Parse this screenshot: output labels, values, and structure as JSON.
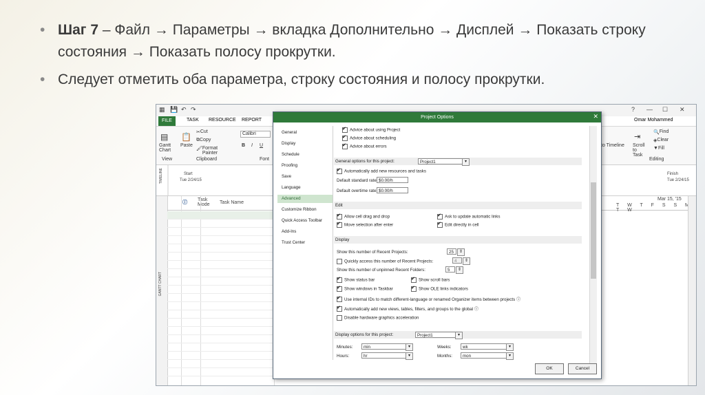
{
  "slide": {
    "bullet1_bold": "Шаг 7",
    "bullet1_text": " – Файл → Параметры → вкладка Дополнительно → Дисплей → Показать строку состояния → Показать полосу прокрутки.",
    "bullet2_text": "Следует отметить оба параметра, строку состояния и полосу прокрутки.",
    "bullet_char": "•"
  },
  "project": {
    "tabs": [
      "FILE",
      "TASK",
      "RESOURCE",
      "REPORT"
    ],
    "user": "Omar Mohammed",
    "ribbon": {
      "gantt_chart": "Gantt Chart",
      "paste": "Paste",
      "cut": "Cut",
      "copy": "Copy",
      "format_painter": "Format Painter",
      "font": "Calibri",
      "view_group": "View",
      "clipboard_group": "Clipboard",
      "font_group": "Font",
      "add_to_timeline": "to Timeline",
      "scroll_to_task": "Scroll to Task",
      "find": "Find",
      "clear": "Clear",
      "fill": "Fill",
      "editing_group": "Editing"
    },
    "timeline": {
      "label": "TIMELINE",
      "start_label": "Start",
      "start_date": "Tue 2/24/15",
      "finish_label": "Finish",
      "finish_date": "Tue 2/24/15"
    },
    "grid": {
      "task_mode": "Task Mode",
      "task_name": "Task Name",
      "gantt_label": "GANTT CHART",
      "date_header": "Mar 15, '15",
      "days": "T W T F S S M T W"
    }
  },
  "dialog": {
    "title": "Project Options",
    "nav": [
      "General",
      "Display",
      "Schedule",
      "Proofing",
      "Save",
      "Language",
      "Advanced",
      "Customize Ribbon",
      "Quick Access Toolbar",
      "Add-Ins",
      "Trust Center"
    ],
    "active_nav": "Advanced",
    "top_opts": [
      {
        "label": "Advice about using Project",
        "checked": true
      },
      {
        "label": "Advice about scheduling",
        "checked": true
      },
      {
        "label": "Advice about errors",
        "checked": true
      }
    ],
    "general_section": "General options for this project:",
    "project_name": "Project1",
    "auto_add": "Automatically add new resources and tasks",
    "std_rate_label": "Default standard rate:",
    "std_rate": "$0.00/h",
    "ot_rate_label": "Default overtime rate:",
    "ot_rate": "$0.00/h",
    "edit_section": "Edit",
    "edit_opts": {
      "drag": "Allow cell drag and drop",
      "move": "Move selection after enter",
      "ask": "Ask to update automatic links",
      "direct": "Edit directly in cell"
    },
    "display_section": "Display",
    "recent_projects_label": "Show this number of Recent Projects:",
    "recent_projects": "25",
    "quick_access_label": "Quickly access this number of Recent Projects:",
    "quick_access": "4",
    "unpinned_label": "Show this number of unpinned Recent Folders:",
    "unpinned": "5",
    "status_bar": "Show status bar",
    "scroll_bars": "Show scroll bars",
    "windows_taskbar": "Show windows in Taskbar",
    "ole_links": "Show OLE links indicators",
    "internal_ids": "Use internal IDs to match different-language or renamed Organizer items between projects",
    "auto_views": "Automatically add new views, tables, filters, and groups to the global",
    "hw_accel": "Disable hardware graphics acceleration",
    "display_opts_label": "Display options for this project:",
    "display_project": "Project1",
    "minutes_label": "Minutes:",
    "minutes": "min",
    "hours_label": "Hours:",
    "hours": "hr",
    "weeks_label": "Weeks:",
    "weeks": "wk",
    "months_label": "Months:",
    "months": "mon",
    "ok": "OK",
    "cancel": "Cancel"
  }
}
